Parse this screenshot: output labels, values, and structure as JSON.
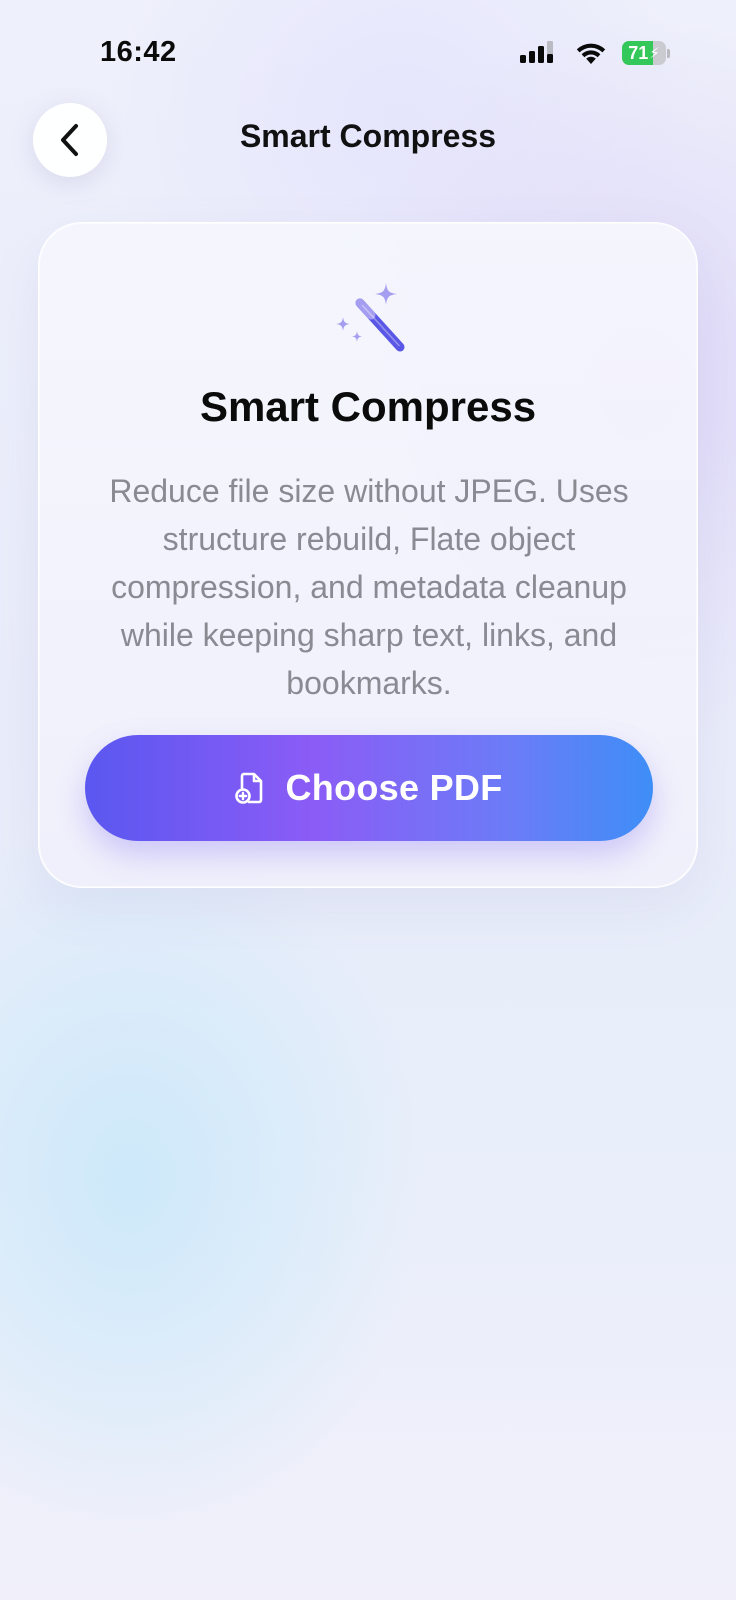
{
  "status_bar": {
    "time": "16:42",
    "battery_level": "71",
    "battery_fraction": 0.71,
    "battery_color": "#34c759",
    "icons": [
      "signal-icon",
      "wifi-icon",
      "battery-icon"
    ]
  },
  "nav": {
    "back_icon": "chevron-left-icon",
    "title": "Smart Compress"
  },
  "card": {
    "icon": "magic-wand-sparkles-icon",
    "accent_color": "#8b86e8",
    "title": "Smart Compress",
    "description": "Reduce file size without JPEG. Uses structure rebuild, Flate object compression, and metadata cleanup while keeping sharp text, links, and bookmarks.",
    "button": {
      "label": "Choose PDF",
      "icon": "document-add-icon",
      "gradient": [
        "#5a57f0",
        "#8b5cf6",
        "#3e8ef7"
      ]
    }
  }
}
